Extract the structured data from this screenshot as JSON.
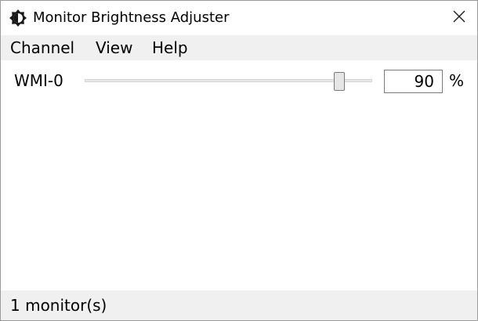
{
  "window": {
    "title": "Monitor Brightness Adjuster"
  },
  "menu": {
    "items": [
      {
        "label": "Channel"
      },
      {
        "label": "View"
      },
      {
        "label": "Help"
      }
    ]
  },
  "monitors": [
    {
      "name": "WMI-0",
      "brightness": 90,
      "brightness_min": 0,
      "brightness_max": 100,
      "value_text": "90",
      "unit": "%"
    }
  ],
  "status": {
    "text": "1 monitor(s)"
  },
  "colors": {
    "menubar_bg": "#f0f0f0",
    "statusbar_bg": "#f0f0f0",
    "window_bg": "#ffffff"
  },
  "icons": {
    "app": "brightness-sun-icon",
    "close": "close-icon"
  }
}
